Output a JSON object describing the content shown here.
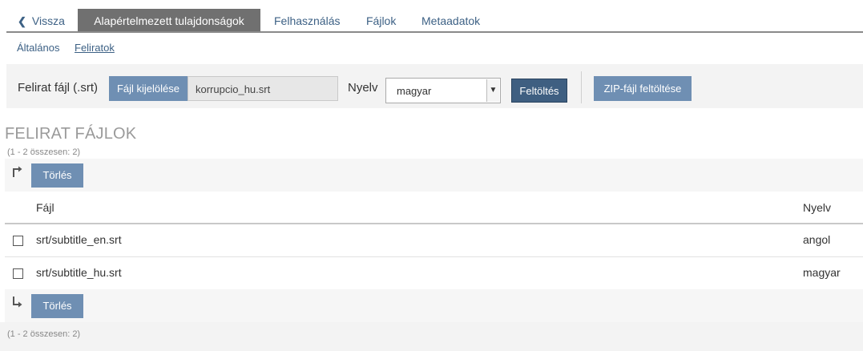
{
  "tabs": {
    "back": "Vissza",
    "active": "Alapértelmezett tulajdonságok",
    "usage": "Felhasználás",
    "files": "Fájlok",
    "metadata": "Metaadatok"
  },
  "subnav": {
    "general": "Általános",
    "subtitles": "Feliratok"
  },
  "upload": {
    "label": "Felirat fájl (.srt)",
    "select_button": "Fájl kijelölése",
    "file_name": "korrupcio_hu.srt",
    "language_label": "Nyelv",
    "language_value": "magyar",
    "upload_button": "Feltöltés",
    "zip_button": "ZIP-fájl feltöltése"
  },
  "section": {
    "title": "FELIRAT FÁJLOK",
    "count": "(1 - 2 összesen: 2)",
    "delete_button": "Törlés"
  },
  "table": {
    "headers": {
      "file": "Fájl",
      "language": "Nyelv"
    },
    "rows": [
      {
        "file": "srt/subtitle_en.srt",
        "language": "angol"
      },
      {
        "file": "srt/subtitle_hu.srt",
        "language": "magyar"
      }
    ]
  },
  "icons": {
    "back": "chevron-left-icon",
    "select_arrow": "chevron-down-icon",
    "top_arrow": "arrow-up-right-icon",
    "bottom_arrow": "arrow-down-right-icon"
  }
}
